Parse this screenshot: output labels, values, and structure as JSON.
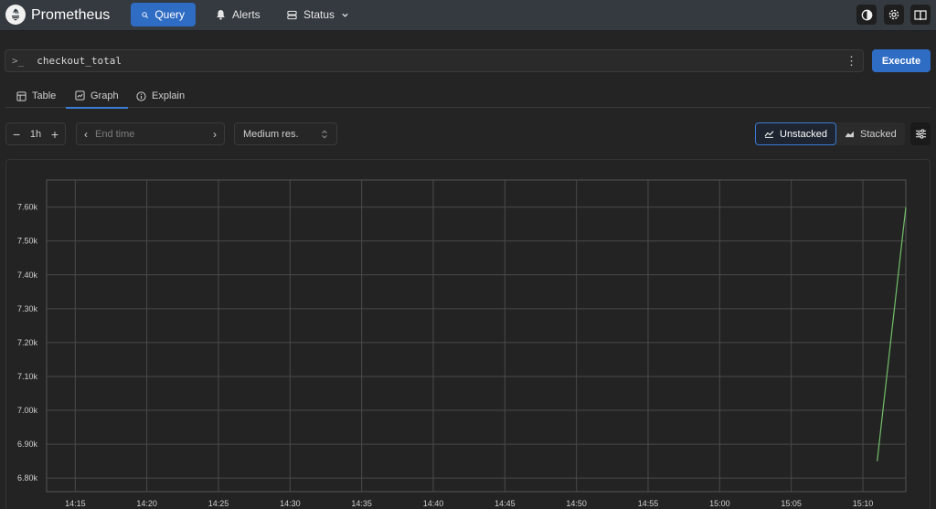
{
  "header": {
    "brand": "Prometheus",
    "nav": [
      {
        "label": "Query",
        "icon": "search-icon"
      },
      {
        "label": "Alerts",
        "icon": "bell-icon"
      },
      {
        "label": "Status",
        "icon": "server-icon"
      }
    ],
    "actions": [
      "theme-toggle-icon",
      "gear-icon",
      "book-icon"
    ]
  },
  "query": {
    "prompt": ">_",
    "expression": "checkout_total",
    "execute_label": "Execute"
  },
  "tabs": [
    {
      "label": "Table",
      "icon": "table-icon"
    },
    {
      "label": "Graph",
      "icon": "graph-icon",
      "active": true
    },
    {
      "label": "Explain",
      "icon": "info-icon"
    }
  ],
  "controls": {
    "range": "1h",
    "end_time_placeholder": "End time",
    "resolution": "Medium res.",
    "unstacked_label": "Unstacked",
    "stacked_label": "Stacked",
    "mode": "Unstacked"
  },
  "colors": {
    "accent": "#2f6cc4",
    "series": "#73bf69"
  },
  "chart_data": {
    "type": "line",
    "title": "",
    "xlabel": "",
    "ylabel": "",
    "x_ticks": [
      "14:15",
      "14:20",
      "14:25",
      "14:30",
      "14:35",
      "14:40",
      "14:45",
      "14:50",
      "14:55",
      "15:00",
      "15:05",
      "15:10"
    ],
    "y_ticks": [
      "6.80k",
      "6.90k",
      "7.00k",
      "7.10k",
      "7.20k",
      "7.30k",
      "7.40k",
      "7.50k",
      "7.60k"
    ],
    "x_range": [
      "14:13",
      "15:13"
    ],
    "ylim": [
      6760,
      7680
    ],
    "grid": true,
    "series": [
      {
        "points": [
          {
            "x": "15:11",
            "y": 6850
          },
          {
            "x": "15:13",
            "y": 7600
          }
        ]
      }
    ]
  }
}
